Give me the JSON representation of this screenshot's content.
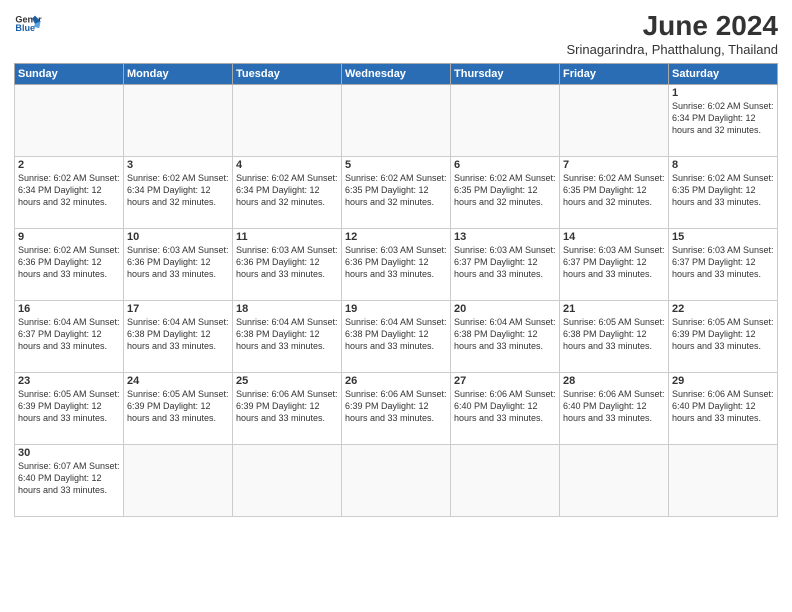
{
  "header": {
    "logo_general": "General",
    "logo_blue": "Blue",
    "month_title": "June 2024",
    "location": "Srinagarindra, Phatthalung, Thailand"
  },
  "weekdays": [
    "Sunday",
    "Monday",
    "Tuesday",
    "Wednesday",
    "Thursday",
    "Friday",
    "Saturday"
  ],
  "days": [
    {
      "date": "",
      "info": ""
    },
    {
      "date": "",
      "info": ""
    },
    {
      "date": "",
      "info": ""
    },
    {
      "date": "",
      "info": ""
    },
    {
      "date": "",
      "info": ""
    },
    {
      "date": "",
      "info": ""
    },
    {
      "date": "1",
      "info": "Sunrise: 6:02 AM\nSunset: 6:34 PM\nDaylight: 12 hours and 32 minutes."
    },
    {
      "date": "2",
      "info": "Sunrise: 6:02 AM\nSunset: 6:34 PM\nDaylight: 12 hours and 32 minutes."
    },
    {
      "date": "3",
      "info": "Sunrise: 6:02 AM\nSunset: 6:34 PM\nDaylight: 12 hours and 32 minutes."
    },
    {
      "date": "4",
      "info": "Sunrise: 6:02 AM\nSunset: 6:34 PM\nDaylight: 12 hours and 32 minutes."
    },
    {
      "date": "5",
      "info": "Sunrise: 6:02 AM\nSunset: 6:35 PM\nDaylight: 12 hours and 32 minutes."
    },
    {
      "date": "6",
      "info": "Sunrise: 6:02 AM\nSunset: 6:35 PM\nDaylight: 12 hours and 32 minutes."
    },
    {
      "date": "7",
      "info": "Sunrise: 6:02 AM\nSunset: 6:35 PM\nDaylight: 12 hours and 32 minutes."
    },
    {
      "date": "8",
      "info": "Sunrise: 6:02 AM\nSunset: 6:35 PM\nDaylight: 12 hours and 33 minutes."
    },
    {
      "date": "9",
      "info": "Sunrise: 6:02 AM\nSunset: 6:36 PM\nDaylight: 12 hours and 33 minutes."
    },
    {
      "date": "10",
      "info": "Sunrise: 6:03 AM\nSunset: 6:36 PM\nDaylight: 12 hours and 33 minutes."
    },
    {
      "date": "11",
      "info": "Sunrise: 6:03 AM\nSunset: 6:36 PM\nDaylight: 12 hours and 33 minutes."
    },
    {
      "date": "12",
      "info": "Sunrise: 6:03 AM\nSunset: 6:36 PM\nDaylight: 12 hours and 33 minutes."
    },
    {
      "date": "13",
      "info": "Sunrise: 6:03 AM\nSunset: 6:37 PM\nDaylight: 12 hours and 33 minutes."
    },
    {
      "date": "14",
      "info": "Sunrise: 6:03 AM\nSunset: 6:37 PM\nDaylight: 12 hours and 33 minutes."
    },
    {
      "date": "15",
      "info": "Sunrise: 6:03 AM\nSunset: 6:37 PM\nDaylight: 12 hours and 33 minutes."
    },
    {
      "date": "16",
      "info": "Sunrise: 6:04 AM\nSunset: 6:37 PM\nDaylight: 12 hours and 33 minutes."
    },
    {
      "date": "17",
      "info": "Sunrise: 6:04 AM\nSunset: 6:38 PM\nDaylight: 12 hours and 33 minutes."
    },
    {
      "date": "18",
      "info": "Sunrise: 6:04 AM\nSunset: 6:38 PM\nDaylight: 12 hours and 33 minutes."
    },
    {
      "date": "19",
      "info": "Sunrise: 6:04 AM\nSunset: 6:38 PM\nDaylight: 12 hours and 33 minutes."
    },
    {
      "date": "20",
      "info": "Sunrise: 6:04 AM\nSunset: 6:38 PM\nDaylight: 12 hours and 33 minutes."
    },
    {
      "date": "21",
      "info": "Sunrise: 6:05 AM\nSunset: 6:38 PM\nDaylight: 12 hours and 33 minutes."
    },
    {
      "date": "22",
      "info": "Sunrise: 6:05 AM\nSunset: 6:39 PM\nDaylight: 12 hours and 33 minutes."
    },
    {
      "date": "23",
      "info": "Sunrise: 6:05 AM\nSunset: 6:39 PM\nDaylight: 12 hours and 33 minutes."
    },
    {
      "date": "24",
      "info": "Sunrise: 6:05 AM\nSunset: 6:39 PM\nDaylight: 12 hours and 33 minutes."
    },
    {
      "date": "25",
      "info": "Sunrise: 6:06 AM\nSunset: 6:39 PM\nDaylight: 12 hours and 33 minutes."
    },
    {
      "date": "26",
      "info": "Sunrise: 6:06 AM\nSunset: 6:39 PM\nDaylight: 12 hours and 33 minutes."
    },
    {
      "date": "27",
      "info": "Sunrise: 6:06 AM\nSunset: 6:40 PM\nDaylight: 12 hours and 33 minutes."
    },
    {
      "date": "28",
      "info": "Sunrise: 6:06 AM\nSunset: 6:40 PM\nDaylight: 12 hours and 33 minutes."
    },
    {
      "date": "29",
      "info": "Sunrise: 6:06 AM\nSunset: 6:40 PM\nDaylight: 12 hours and 33 minutes."
    },
    {
      "date": "30",
      "info": "Sunrise: 6:07 AM\nSunset: 6:40 PM\nDaylight: 12 hours and 33 minutes."
    }
  ]
}
